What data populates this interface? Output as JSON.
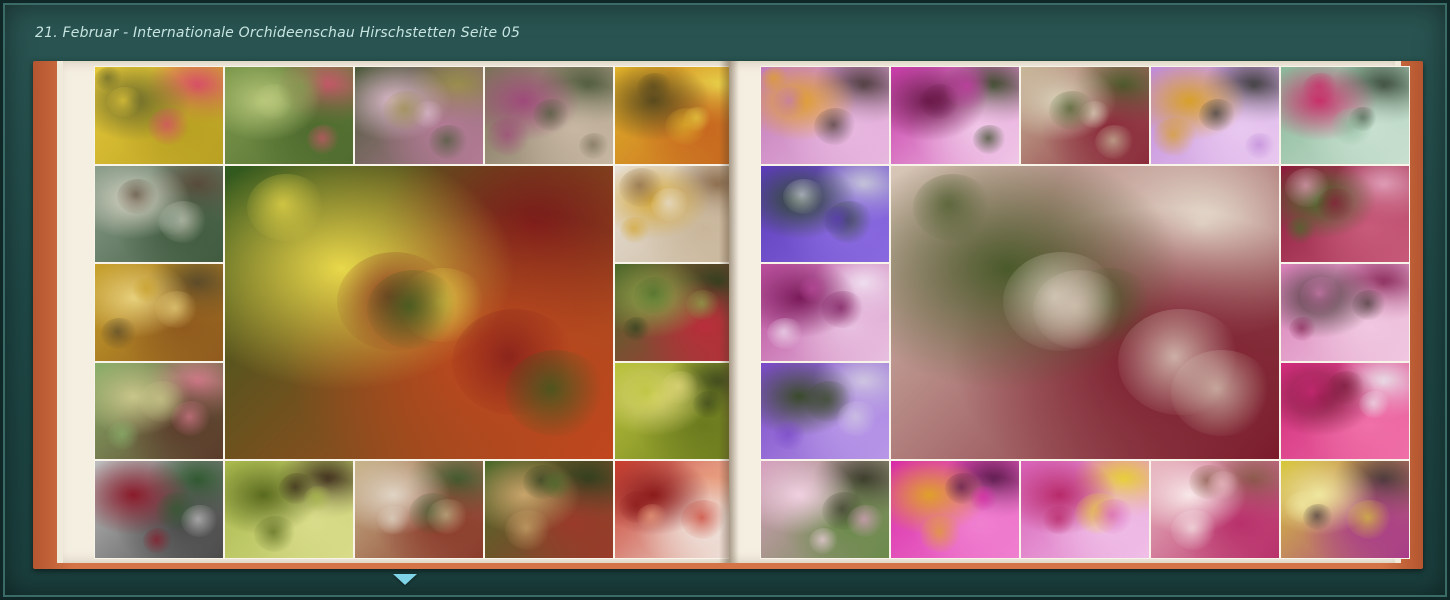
{
  "header": {
    "title": "21. Februar - Internationale Orchideenschau Hirschstetten  Seite 05"
  },
  "book": {
    "left_page": {
      "photos": [
        {
          "name": "photo-yellow-phalaenopsis",
          "colors": [
            "#e6c93a",
            "#b8a022",
            "#6b6a2a",
            "#d94a6a"
          ]
        },
        {
          "name": "photo-pitcher-plants-green",
          "colors": [
            "#7f9b4e",
            "#4f6b2e",
            "#b8c77a",
            "#c9566a"
          ]
        },
        {
          "name": "photo-slipper-orchid-spotted",
          "colors": [
            "#4c5a3a",
            "#b47b96",
            "#d9b8c8",
            "#9a8f4a"
          ]
        },
        {
          "name": "photo-orchid-display-branches",
          "colors": [
            "#7a7058",
            "#c7b7a3",
            "#9f4a7a",
            "#4d5a3a"
          ]
        },
        {
          "name": "photo-yellow-oncidium",
          "colors": [
            "#e0b22a",
            "#c76820",
            "#5a4a1e",
            "#e8d24a"
          ]
        },
        {
          "name": "photo-greenhouse-fountain",
          "colors": [
            "#8c9f8c",
            "#3f5a3f",
            "#d7d4c4",
            "#5a4a3a"
          ]
        },
        {
          "name": "photo-paphiopedilum-large",
          "colors": [
            "#2f5a1e",
            "#c2461e",
            "#e8d84a",
            "#7a1a1a"
          ]
        },
        {
          "name": "photo-white-phalaenopsis",
          "colors": [
            "#e8e1d8",
            "#c9b69a",
            "#d4a83a",
            "#8a6a4a"
          ]
        },
        {
          "name": "photo-yellow-paphiopedilum",
          "colors": [
            "#c7a02a",
            "#8f5a1e",
            "#e7cf7a",
            "#5a4a2a"
          ]
        },
        {
          "name": "photo-red-pitcher-plants",
          "colors": [
            "#4a6a2a",
            "#b82e3a",
            "#8fa34a",
            "#2f3f1e"
          ]
        },
        {
          "name": "photo-orchid-bark-display",
          "colors": [
            "#8ab06a",
            "#5a3a2a",
            "#c9c68a",
            "#d27a8a"
          ]
        },
        {
          "name": "photo-green-cymbidium",
          "colors": [
            "#b9c33a",
            "#6a7a1e",
            "#e0d87a",
            "#3f4a1e"
          ]
        },
        {
          "name": "photo-owl-figurine",
          "colors": [
            "#bfbfbf",
            "#4a4a4a",
            "#8a1a2a",
            "#2f5a2f"
          ]
        },
        {
          "name": "photo-green-slipper-bloom",
          "colors": [
            "#a7b84a",
            "#d9dc8a",
            "#5a6a1e",
            "#3a2a1a"
          ]
        },
        {
          "name": "photo-exhibition-stand",
          "colors": [
            "#c7b48a",
            "#8a3a2a",
            "#e0d4c4",
            "#3f5a2f"
          ]
        },
        {
          "name": "photo-nepenthes-hanging",
          "colors": [
            "#4a6a2a",
            "#9a3a2a",
            "#c7a46a",
            "#2f3f1e"
          ]
        },
        {
          "name": "photo-red-white-oncidium",
          "colors": [
            "#c73a2a",
            "#f0e8e0",
            "#8a1a1a",
            "#e89a7a"
          ]
        }
      ]
    },
    "right_page": {
      "photos": [
        {
          "name": "photo-lilac-cattleya",
          "colors": [
            "#c27ab8",
            "#e8b8e0",
            "#e0a02a",
            "#4a3a3a"
          ]
        },
        {
          "name": "photo-magenta-spotted-phal",
          "colors": [
            "#c83aa8",
            "#f0c8e8",
            "#6a1a4a",
            "#3a4a2a"
          ]
        },
        {
          "name": "photo-veined-pitcher-plant",
          "colors": [
            "#c8b89a",
            "#8a2a3a",
            "#d8d0b8",
            "#4a5a2a"
          ]
        },
        {
          "name": "photo-lavender-cattleya",
          "colors": [
            "#c08ad8",
            "#e8c8f0",
            "#d8a02a",
            "#3a3a3a"
          ]
        },
        {
          "name": "photo-bromeliad-rosette",
          "colors": [
            "#8ab89a",
            "#c8e0d0",
            "#c8306a",
            "#3a4a3a"
          ]
        },
        {
          "name": "photo-blue-vanda",
          "colors": [
            "#5a3ab8",
            "#8a6ae0",
            "#2f4a2f",
            "#c8c8d8"
          ]
        },
        {
          "name": "photo-cymbidium-spotted-large",
          "colors": [
            "#d8c8b8",
            "#7a1a2a",
            "#4a5a2a",
            "#e8e0d0"
          ]
        },
        {
          "name": "photo-pitcher-plants-red",
          "colors": [
            "#8a1a3a",
            "#c85a7a",
            "#4a6a2a",
            "#e0a0b8"
          ]
        },
        {
          "name": "photo-pink-patterned-phal",
          "colors": [
            "#b84a9a",
            "#e8c0e0",
            "#7a1a5a",
            "#f0e0f0"
          ]
        },
        {
          "name": "photo-pink-phal-spray",
          "colors": [
            "#d880b8",
            "#f0c8e0",
            "#4a3a3a",
            "#8a2a5a"
          ]
        },
        {
          "name": "photo-purple-vanda-cluster",
          "colors": [
            "#7a4ac8",
            "#b898e8",
            "#3a4a2a",
            "#d0c8e0"
          ]
        },
        {
          "name": "photo-magenta-phalaenopsis",
          "colors": [
            "#d02a7a",
            "#f070a8",
            "#7a1a3a",
            "#e8e0e8"
          ]
        },
        {
          "name": "photo-pink-dendrobium",
          "colors": [
            "#d8a0c0",
            "#6a8a4a",
            "#f0d0e0",
            "#3a3a2a"
          ]
        },
        {
          "name": "photo-magenta-cattleya",
          "colors": [
            "#d82aa8",
            "#f080d0",
            "#e0a02a",
            "#5a1a4a"
          ]
        },
        {
          "name": "photo-pink-cattleya-ruffled",
          "colors": [
            "#d860b8",
            "#f0c0e8",
            "#b82a6a",
            "#e8d030"
          ]
        },
        {
          "name": "photo-peach-spotted-phal",
          "colors": [
            "#e8b8c0",
            "#b8306a",
            "#f8e8e8",
            "#8a5a4a"
          ]
        },
        {
          "name": "photo-yellow-purple-phal",
          "colors": [
            "#d8c83a",
            "#a83a8a",
            "#f0e8a0",
            "#4a3a3a"
          ]
        }
      ]
    }
  },
  "navigation": {
    "down_arrow_icon": "triangle-down-icon",
    "arrow_color": "#7fd3e6"
  },
  "theme": {
    "frame": "#1f4846",
    "title_color": "#c7e4e0",
    "cover": "#d47446",
    "paper": "#f5efe2"
  }
}
